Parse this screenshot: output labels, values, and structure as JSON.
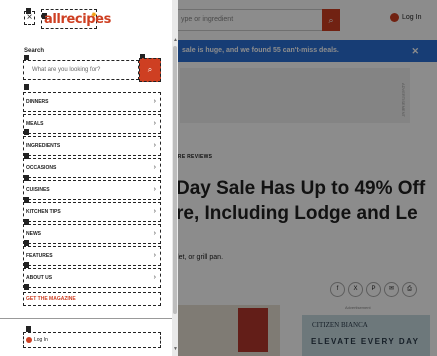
{
  "background": {
    "search_placeholder": "ype or ingredient",
    "search_icon": "search-icon",
    "login_label": "Log In",
    "banner_text": "sale is huge, and we found 55 can't-miss deals.",
    "banner_close": "✕",
    "ad_label": "ADVERTISEMENT",
    "kicker": "ARE REVIEWS",
    "headline_line1": "Day Sale Has Up to 49% Off",
    "headline_line2": "re, Including Lodge and Le",
    "dek": "illet, or grill pan.",
    "share_buttons": [
      "f",
      "X",
      "P",
      "✉",
      "⎙"
    ],
    "ad2_label": "Advertisement",
    "ad2_brand": "CITIZEN  BIANCA",
    "ad2_tagline": "ELEVATE EVERY DAY",
    "peek": [
      "e",
      "e",
      "t"
    ]
  },
  "drawer": {
    "close_label": "×",
    "logo": "allrecipes",
    "search_label": "Search",
    "search_placeholder": "What are you looking for?",
    "search_button": "⌕",
    "nav_items": [
      {
        "label": "DINNERS"
      },
      {
        "label": "MEALS"
      },
      {
        "label": "INGREDIENTS"
      },
      {
        "label": "OCCASIONS"
      },
      {
        "label": "CUISINES"
      },
      {
        "label": "KITCHEN TIPS"
      },
      {
        "label": "NEWS"
      },
      {
        "label": "FEATURES"
      },
      {
        "label": "ABOUT US"
      }
    ],
    "chevron": "›",
    "magazine_link": "GET THE MAGAZINE",
    "login_label": "Log In"
  },
  "colors": {
    "brand": "#ce3f22",
    "banner": "#2a6fd6"
  }
}
